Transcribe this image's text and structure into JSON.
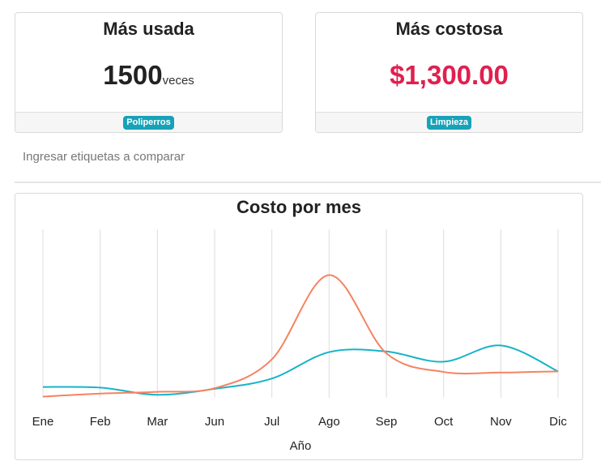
{
  "cards": {
    "most_used": {
      "title": "Más usada",
      "value": "1500",
      "unit": "veces",
      "tag": "Poliperros"
    },
    "most_expensive": {
      "title": "Más costosa",
      "value": "$1,300.00",
      "tag": "Limpieza"
    }
  },
  "tag_input": {
    "placeholder": "Ingresar etiquetas a comparar"
  },
  "chart_data": {
    "type": "line",
    "title": "Costo por mes",
    "xlabel": "Año",
    "ylabel": "",
    "categories": [
      "Ene",
      "Feb",
      "Mar",
      "Jun",
      "Jul",
      "Ago",
      "Sep",
      "Oct",
      "Nov",
      "Dic"
    ],
    "ylim": [
      0,
      1400
    ],
    "grid": "vertical",
    "series": [
      {
        "color": "#17b3c9",
        "values": [
          90,
          85,
          25,
          75,
          160,
          380,
          385,
          300,
          435,
          220
        ]
      },
      {
        "color": "#f58362",
        "values": [
          10,
          35,
          50,
          80,
          320,
          1020,
          370,
          215,
          210,
          220
        ]
      }
    ]
  }
}
